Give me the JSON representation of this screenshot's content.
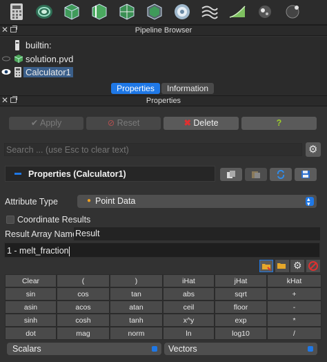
{
  "toolbar": {
    "icons": [
      "calculator-icon",
      "contour-icon",
      "clip-icon",
      "slice-icon",
      "threshold-icon",
      "extract-subset-icon",
      "glyph-icon",
      "stream-tracer-icon",
      "warp-by-vector-icon",
      "group-datasets-icon",
      "extract-level-icon"
    ]
  },
  "pipeline": {
    "title": "Pipeline Browser",
    "items": [
      {
        "label": "builtin:"
      },
      {
        "label": "solution.pvd"
      },
      {
        "label": "Calculator1"
      }
    ]
  },
  "tabs": {
    "properties": "Properties",
    "information": "Information"
  },
  "properties": {
    "title": "Properties",
    "apply": "Apply",
    "reset": "Reset",
    "delete": "Delete",
    "help": "?",
    "search_placeholder": "Search ... (use Esc to clear text)",
    "section_title": "Properties (Calculator1)",
    "attribute_type_label": "Attribute Type",
    "attribute_type_value": "Point Data",
    "coordinate_results_label": "Coordinate Results",
    "coordinate_results_checked": false,
    "result_array_label": "Result Array Name",
    "result_array_value": "Result",
    "expression": "1 - melt_fraction"
  },
  "calculator": {
    "keys": [
      [
        "Clear",
        "(",
        ")",
        "iHat",
        "jHat",
        "kHat"
      ],
      [
        "sin",
        "cos",
        "tan",
        "abs",
        "sqrt",
        "+"
      ],
      [
        "asin",
        "acos",
        "atan",
        "ceil",
        "floor",
        "-"
      ],
      [
        "sinh",
        "cosh",
        "tanh",
        "x^y",
        "exp",
        "*"
      ],
      [
        "dot",
        "mag",
        "norm",
        "ln",
        "log10",
        "/"
      ]
    ],
    "scalars": "Scalars",
    "vectors": "Vectors"
  },
  "colors": {
    "accent": "#1f78e6",
    "delete_red": "#e03030",
    "help_green": "#9ccc2a",
    "selection": "#3b5f8a"
  }
}
